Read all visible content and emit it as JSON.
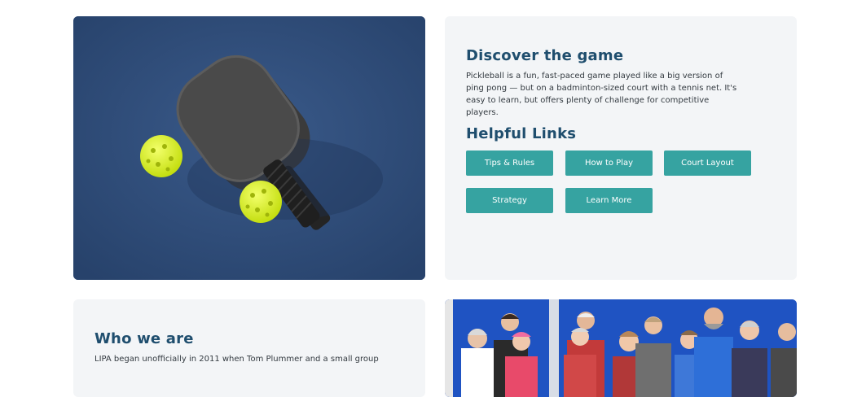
{
  "discover": {
    "title": "Discover the game",
    "text": "Pickleball is a fun, fast-paced game played like a big version of ping pong — but on a badminton-sized court with a tennis net. It's easy to learn, but offers plenty of challenge for competitive players."
  },
  "links": {
    "title": "Helpful Links",
    "buttons": [
      "Tips & Rules",
      "How to Play",
      "Court Layout",
      "Strategy",
      "Learn More"
    ]
  },
  "who": {
    "title": "Who we are",
    "text": "LIPA began unofficially in 2011 when Tom Plummer and a small group"
  },
  "colors": {
    "accent": "#36a3a1",
    "heading": "#1f4e6e",
    "card_bg": "#f3f5f7",
    "court_blue": "#2e4c7a",
    "ball_yellow": "#d9f21f"
  }
}
